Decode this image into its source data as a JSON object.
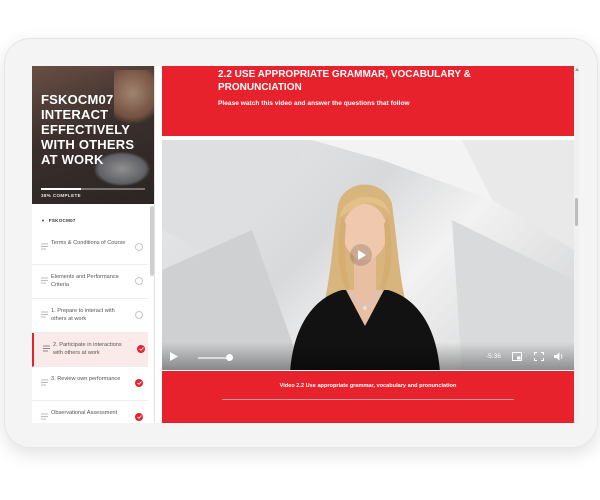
{
  "course": {
    "title": "FSKOCM07 INTERACT EFFECTIVELY WITH OTHERS AT WORK",
    "progress_label": "38% COMPLETE",
    "progress_fraction": 0.38,
    "module_label": "FSKOCM07"
  },
  "sidebar": {
    "items": [
      {
        "label": "Terms & Conditions of Course",
        "status": "empty"
      },
      {
        "label": "Elements and Performance Criteria",
        "status": "empty"
      },
      {
        "label": "1. Prepare to interact with others at work",
        "status": "empty"
      },
      {
        "label": "2. Participate in interactions with others at work",
        "status": "done",
        "active": true
      },
      {
        "label": "3. Review own performance",
        "status": "done"
      },
      {
        "label": "Observational Assessment",
        "status": "done"
      }
    ]
  },
  "lesson": {
    "title": "2.2 USE APPROPRIATE GRAMMAR, VOCABULARY & PRONUNCIATION",
    "instruction": "Please watch this video and answer the questions that follow"
  },
  "video": {
    "time": "-5:36",
    "volume_fraction": 0.9,
    "caption": "Video 2.2 Use appropriate grammar, vocabulary and pronunciation"
  },
  "colors": {
    "accent": "#e8222d",
    "header_dark": "#3b2f2c"
  },
  "icons": [
    "document-icon",
    "checkmark-icon",
    "play-icon",
    "pip-icon",
    "fullscreen-icon",
    "volume-icon",
    "chevron-down-icon"
  ]
}
